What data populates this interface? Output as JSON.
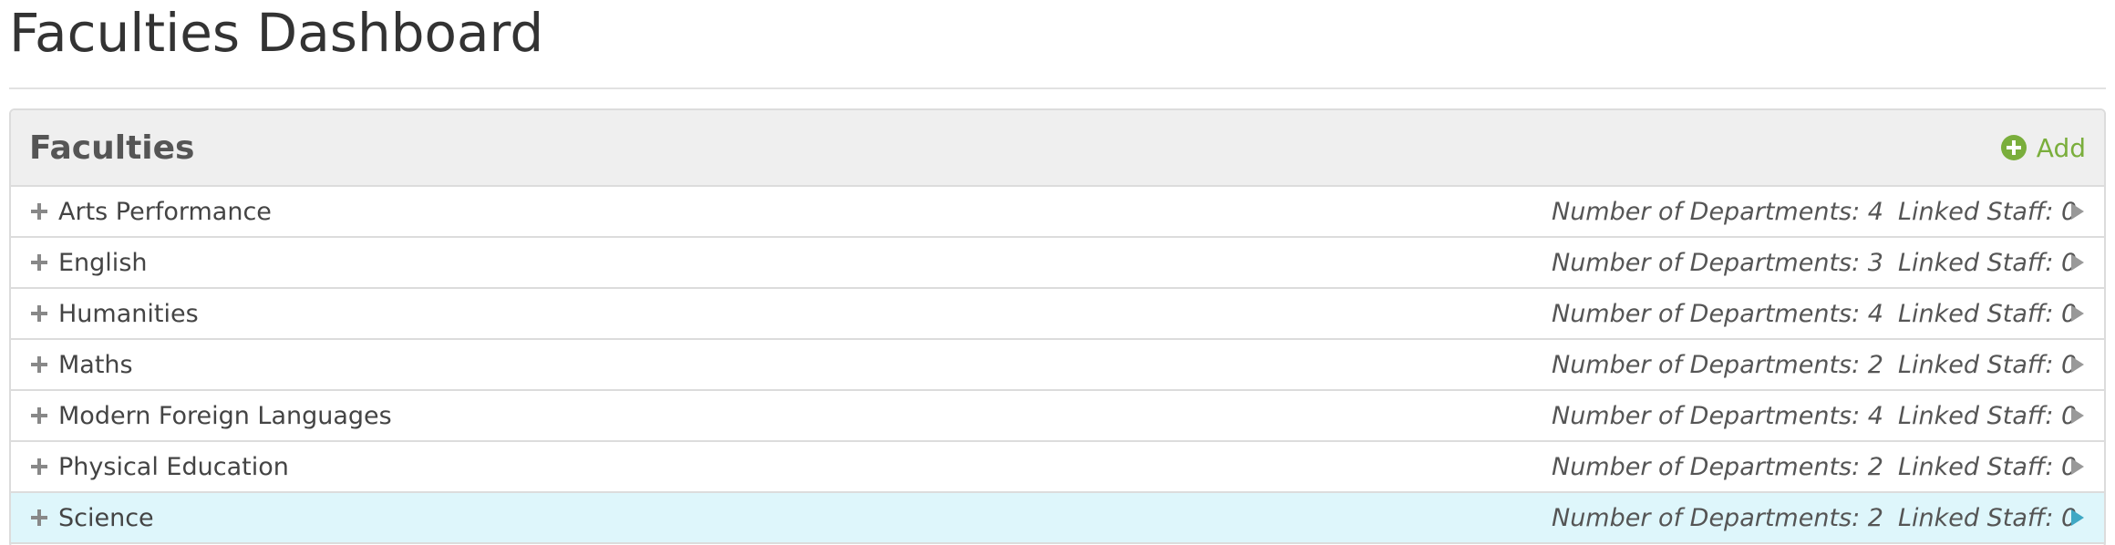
{
  "page": {
    "title": "Faculties Dashboard"
  },
  "panel": {
    "title": "Faculties",
    "add_label": "Add",
    "add_icon": "plus-circle-icon"
  },
  "colors": {
    "accent_green": "#7aae3c",
    "highlight_row": "#def6fb",
    "highlight_arrow": "#3fa8c4",
    "arrow_gray": "#999999"
  },
  "rows": [
    {
      "name": "Arts Performance",
      "departments": "Number of Departments: 4",
      "staff": "Linked Staff: 0",
      "highlighted": false
    },
    {
      "name": "English",
      "departments": "Number of Departments: 3",
      "staff": "Linked Staff: 0",
      "highlighted": false
    },
    {
      "name": "Humanities",
      "departments": "Number of Departments: 4",
      "staff": "Linked Staff: 0",
      "highlighted": false
    },
    {
      "name": "Maths",
      "departments": "Number of Departments: 2",
      "staff": "Linked Staff: 0",
      "highlighted": false
    },
    {
      "name": "Modern Foreign Languages",
      "departments": "Number of Departments: 4",
      "staff": "Linked Staff: 0",
      "highlighted": false
    },
    {
      "name": "Physical Education",
      "departments": "Number of Departments: 2",
      "staff": "Linked Staff: 0",
      "highlighted": false
    },
    {
      "name": "Science",
      "departments": "Number of Departments: 2",
      "staff": "Linked Staff: 0",
      "highlighted": true
    }
  ]
}
